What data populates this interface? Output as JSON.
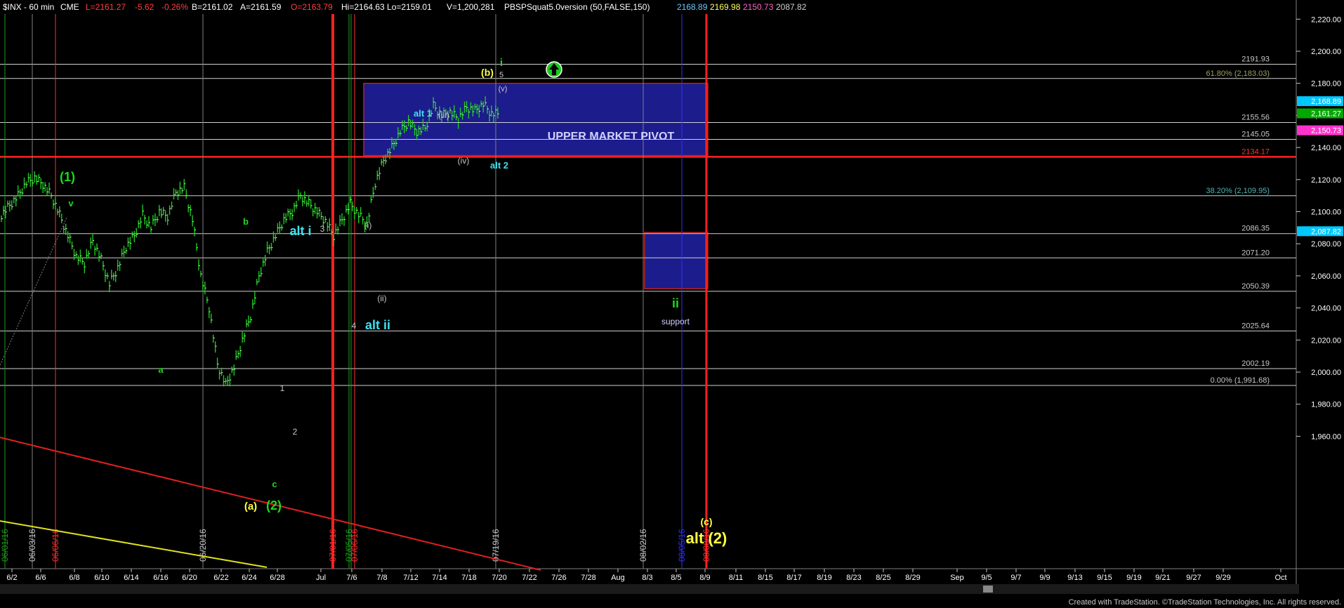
{
  "header": {
    "symbol": "$INX - 60 min",
    "exchange": "CME",
    "last": "L=2161.27",
    "change": "-5.62",
    "change_pct": "-0.26%",
    "bid": "B=2161.02",
    "ask": "A=2161.59",
    "open": "O=2163.79",
    "hilo": "Hi=2164.63  Lo=2159.01",
    "volume": "V=1,200,281",
    "study": "PBSPSquat5.0version (50,FALSE,150)",
    "study_values": [
      "2168.89",
      "2169.98",
      "2150.73",
      "2087.82"
    ],
    "study_colors": [
      "#6ec8ff",
      "#ffff66",
      "#ff66cc",
      "#d0d0d0"
    ]
  },
  "chart_data": {
    "type": "line",
    "title": "$INX - 60 min",
    "price_axis": {
      "ylim": [
        1950,
        2225
      ],
      "ticks": [
        "2,220.00",
        "2,200.00",
        "2,180.00",
        "2,160.00",
        "2,140.00",
        "2,120.00",
        "2,100.00",
        "2,080.00",
        "2,060.00",
        "2,040.00",
        "2,020.00",
        "2,000.00",
        "1,980.00",
        "1,960.00"
      ],
      "tick_values": [
        2220,
        2200,
        2180,
        2160,
        2140,
        2120,
        2100,
        2080,
        2060,
        2040,
        2020,
        2000,
        1980,
        1960
      ],
      "tags": [
        {
          "value": 2168.89,
          "label": "2,168.89",
          "color": "#00c8ff"
        },
        {
          "value": 2161.27,
          "label": "2,161.27",
          "color": "#00a800"
        },
        {
          "value": 2150.73,
          "label": "2,150.73",
          "color": "#ff33cc"
        },
        {
          "value": 2087.82,
          "label": "2,087.82",
          "color": "#00c8ff"
        }
      ]
    },
    "date_axis": {
      "labels": [
        "6/2",
        "6/6",
        "6/8",
        "6/10",
        "6/14",
        "6/16",
        "6/20",
        "6/22",
        "6/24",
        "6/28",
        "Jul",
        "7/6",
        "7/8",
        "7/12",
        "7/14",
        "7/18",
        "7/20",
        "7/22",
        "7/26",
        "7/28",
        "Aug",
        "8/3",
        "8/5",
        "8/9",
        "8/11",
        "8/15",
        "8/17",
        "8/19",
        "8/23",
        "8/25",
        "8/29",
        "Sep",
        "9/5",
        "9/7",
        "9/9",
        "9/13",
        "9/15",
        "9/19",
        "9/21",
        "9/27",
        "9/29",
        "Oct"
      ]
    },
    "horizontal_levels": [
      {
        "value": 2191.93,
        "label": "2191.93",
        "color": "#c8c8c8"
      },
      {
        "value": 2183.03,
        "label": "61.80% (2,183.03)",
        "color": "#a0a060"
      },
      {
        "value": 2155.56,
        "label": "2155.56",
        "color": "#c8c8c8"
      },
      {
        "value": 2145.05,
        "label": "2145.05",
        "color": "#c8c8c8"
      },
      {
        "value": 2134.17,
        "label": "2134.17",
        "color": "#ff3030"
      },
      {
        "value": 2109.95,
        "label": "38.20% (2,109.95)",
        "color": "#50b4b4"
      },
      {
        "value": 2086.35,
        "label": "2086.35",
        "color": "#c8c8c8"
      },
      {
        "value": 2071.2,
        "label": "2071.20",
        "color": "#c8c8c8"
      },
      {
        "value": 2050.39,
        "label": "2050.39",
        "color": "#c8c8c8"
      },
      {
        "value": 2025.64,
        "label": "2025.64",
        "color": "#c8c8c8"
      },
      {
        "value": 2002.19,
        "label": "2002.19",
        "color": "#c8c8c8"
      },
      {
        "value": 1991.68,
        "label": "0.00% (1,991.68)",
        "color": "#c8c8c8"
      }
    ],
    "vertical_date_labels": [
      {
        "label": "06/01/16",
        "color": "#1e9e1e"
      },
      {
        "label": "06/03/16",
        "color": "#c8c8c8"
      },
      {
        "label": "06/06/16",
        "color": "#ff3030"
      },
      {
        "label": "06/20/16",
        "color": "#c8c8c8"
      },
      {
        "label": "07/01/16",
        "color": "#ff3030"
      },
      {
        "label": "07/05/16",
        "color": "#1e9e1e"
      },
      {
        "label": "07/06/16",
        "color": "#ff3030"
      },
      {
        "label": "07/19/16",
        "color": "#c8c8c8"
      },
      {
        "label": "08/02/16",
        "color": "#c8c8c8"
      },
      {
        "label": "08/05/16",
        "color": "#3030ff"
      },
      {
        "label": "08/08/16",
        "color": "#ff3030"
      }
    ],
    "zones": [
      {
        "label": "UPPER MARKET PIVOT",
        "range": [
          2135,
          2180
        ],
        "color": "#1c1c8c"
      },
      {
        "label": "support",
        "range": [
          2052,
          2087
        ],
        "color": "#1c1c8c",
        "tag": "ii"
      }
    ],
    "price_path": [
      2098,
      2104,
      2110,
      2118,
      2121,
      2117,
      2110,
      2098,
      2085,
      2072,
      2068,
      2082,
      2070,
      2055,
      2065,
      2078,
      2085,
      2098,
      2090,
      2100,
      2097,
      2112,
      2115,
      2095,
      2060,
      2040,
      2005,
      1992,
      2003,
      2020,
      2035,
      2060,
      2075,
      2085,
      2095,
      2100,
      2110,
      2105,
      2100,
      2094,
      2085,
      2095,
      2105,
      2098,
      2092,
      2118,
      2132,
      2140,
      2150,
      2156,
      2150,
      2152,
      2166,
      2160,
      2162,
      2158,
      2165,
      2163,
      2167,
      2161
    ]
  },
  "annotations": {
    "wave_1": "(1)",
    "wave_v": "v",
    "wave_a_small": "a",
    "wave_b": "b",
    "wave_c": "c",
    "wave_a_paren": "(a)",
    "wave_2_paren": "(2)",
    "alt_i": "alt i",
    "num_3": "3",
    "num_4": "4",
    "alt_ii": "alt ii",
    "num_1": "1",
    "num_2": "2",
    "paren_i": "(i)",
    "paren_ii": "(ii)",
    "alt_1": "alt 1",
    "paren_iii": "(iii)",
    "paren_iv": "(iv)",
    "alt_2": "alt 2",
    "b_paren": "(b)",
    "small_i": "i",
    "num_5": "5",
    "paren_v": "(v)",
    "c_paren": "(c)",
    "alt_2_big": "alt (2)",
    "arrow": "up-arrow-icon"
  },
  "footer": {
    "credit": "Created with TradeStation. ©TradeStation Technologies, Inc. All rights reserved."
  }
}
